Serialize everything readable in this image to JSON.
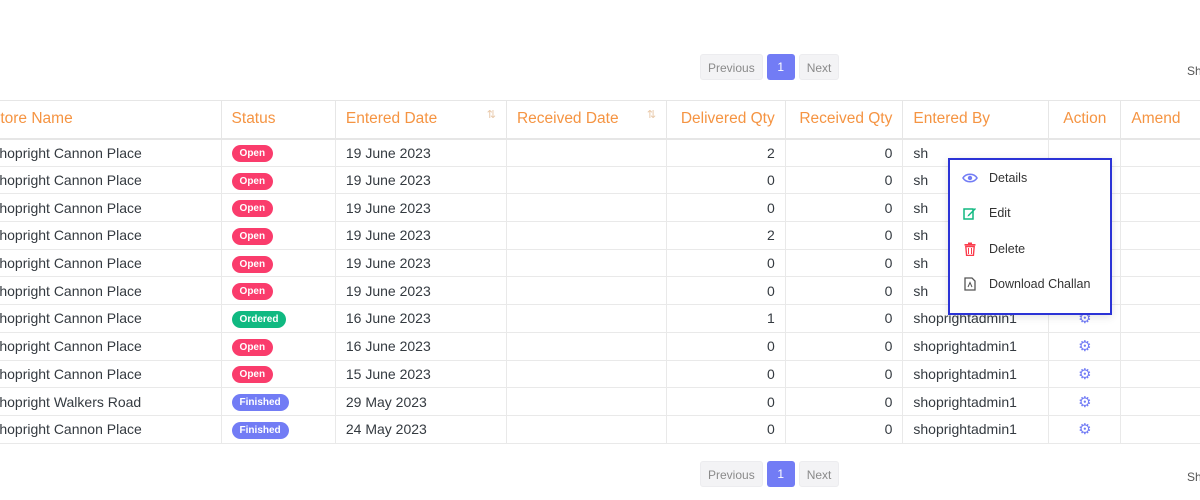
{
  "top_pagination": {
    "previous": "Previous",
    "page": "1",
    "next": "Next"
  },
  "bottom_pagination": {
    "previous": "Previous",
    "page": "1",
    "next": "Next"
  },
  "edge_right_label": "Sh",
  "table": {
    "headers": [
      "Store Name",
      "Status",
      "Entered Date",
      "Received Date",
      "Delivered Qty",
      "Received Qty",
      "Entered By",
      "Action",
      "Amend"
    ],
    "rows": [
      {
        "store": "Shopright Cannon Place",
        "status": "Open",
        "status_color": "#fa3c6c",
        "entered_date": "19 June 2023",
        "received_date": "",
        "delivered_qty": "2",
        "received_qty": "0",
        "entered_by": "sh"
      },
      {
        "store": "Shopright Cannon Place",
        "status": "Open",
        "status_color": "#fa3c6c",
        "entered_date": "19 June 2023",
        "received_date": "",
        "delivered_qty": "0",
        "received_qty": "0",
        "entered_by": "sh"
      },
      {
        "store": "Shopright Cannon Place",
        "status": "Open",
        "status_color": "#fa3c6c",
        "entered_date": "19 June 2023",
        "received_date": "",
        "delivered_qty": "0",
        "received_qty": "0",
        "entered_by": "sh"
      },
      {
        "store": "Shopright Cannon Place",
        "status": "Open",
        "status_color": "#fa3c6c",
        "entered_date": "19 June 2023",
        "received_date": "",
        "delivered_qty": "2",
        "received_qty": "0",
        "entered_by": "sh"
      },
      {
        "store": "Shopright Cannon Place",
        "status": "Open",
        "status_color": "#fa3c6c",
        "entered_date": "19 June 2023",
        "received_date": "",
        "delivered_qty": "0",
        "received_qty": "0",
        "entered_by": "sh"
      },
      {
        "store": "Shopright Cannon Place",
        "status": "Open",
        "status_color": "#fa3c6c",
        "entered_date": "19 June 2023",
        "received_date": "",
        "delivered_qty": "0",
        "received_qty": "0",
        "entered_by": "sh"
      },
      {
        "store": "Shopright Cannon Place",
        "status": "Ordered",
        "status_color": "#10b981",
        "entered_date": "16 June 2023",
        "received_date": "",
        "delivered_qty": "1",
        "received_qty": "0",
        "entered_by": "shoprightadmin1"
      },
      {
        "store": "Shopright Cannon Place",
        "status": "Open",
        "status_color": "#fa3c6c",
        "entered_date": "16 June 2023",
        "received_date": "",
        "delivered_qty": "0",
        "received_qty": "0",
        "entered_by": "shoprightadmin1"
      },
      {
        "store": "Shopright Cannon Place",
        "status": "Open",
        "status_color": "#fa3c6c",
        "entered_date": "15 June 2023",
        "received_date": "",
        "delivered_qty": "0",
        "received_qty": "0",
        "entered_by": "shoprightadmin1"
      },
      {
        "store": "Shopright Walkers Road",
        "status": "Finished",
        "status_color": "#727cf5",
        "entered_date": "29 May 2023",
        "received_date": "",
        "delivered_qty": "0",
        "received_qty": "0",
        "entered_by": "shoprightadmin1"
      },
      {
        "store": "Shopright Cannon Place",
        "status": "Finished",
        "status_color": "#727cf5",
        "entered_date": "24 May 2023",
        "received_date": "",
        "delivered_qty": "0",
        "received_qty": "0",
        "entered_by": "shoprightadmin1"
      }
    ]
  },
  "action_menu": {
    "items": [
      {
        "label": "Details",
        "icon": "eye-icon",
        "color": "#727cf5"
      },
      {
        "label": "Edit",
        "icon": "edit-icon",
        "color": "#10b981"
      },
      {
        "label": "Delete",
        "icon": "trash-icon",
        "color": "#fa3c4c"
      },
      {
        "label": "Download Challan",
        "icon": "document-icon",
        "color": "#555555"
      }
    ]
  }
}
